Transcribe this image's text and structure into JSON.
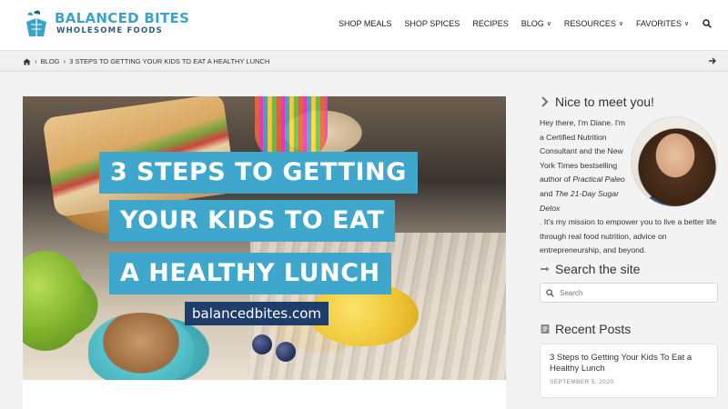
{
  "brand": {
    "title": "BALANCED BITES",
    "subtitle": "WHOLESOME FOODS",
    "primary_color": "#3aa3c8",
    "secondary_color": "#2c5f7a"
  },
  "nav": {
    "items": [
      {
        "label": "SHOP MEALS",
        "has_dropdown": false
      },
      {
        "label": "SHOP SPICES",
        "has_dropdown": false
      },
      {
        "label": "RECIPES",
        "has_dropdown": false
      },
      {
        "label": "BLOG",
        "has_dropdown": true
      },
      {
        "label": "RESOURCES",
        "has_dropdown": true
      },
      {
        "label": "FAVORITES",
        "has_dropdown": true
      }
    ],
    "search_icon": "search-icon"
  },
  "breadcrumb": {
    "home_icon": "home-icon",
    "items": [
      "BLOG",
      "3 STEPS TO GETTING YOUR KIDS TO EAT A HEALTHY LUNCH"
    ],
    "next_icon": "arrow-right-icon"
  },
  "hero": {
    "line1": "3 STEPS TO GETTING",
    "line2": "YOUR KIDS TO EAT",
    "line3": "A HEALTHY LUNCH",
    "url": "balancedbites.com",
    "banner_color": "#3fa7cc",
    "url_bg_color": "#1e3d6b"
  },
  "sidebar": {
    "intro": {
      "heading": "Nice to meet you!",
      "p1": "Hey there, I'm Diane. I'm a Certified Nutrition Consultant and the New York Times bestselling author of",
      "book1": "Practical Paleo",
      "and": "and",
      "book2": "The 21-Day Sugar Detox",
      "p2": ". It's my mission to empower you to live a better life through real food nutrition, advice on entrepreneurship, and beyond."
    },
    "search": {
      "heading": "Search the site",
      "placeholder": "Search"
    },
    "recent": {
      "heading": "Recent Posts",
      "posts": [
        {
          "title": "3 Steps to Getting Your Kids To Eat a Healthy Lunch",
          "date": "SEPTEMBER 5, 2020"
        }
      ]
    }
  }
}
